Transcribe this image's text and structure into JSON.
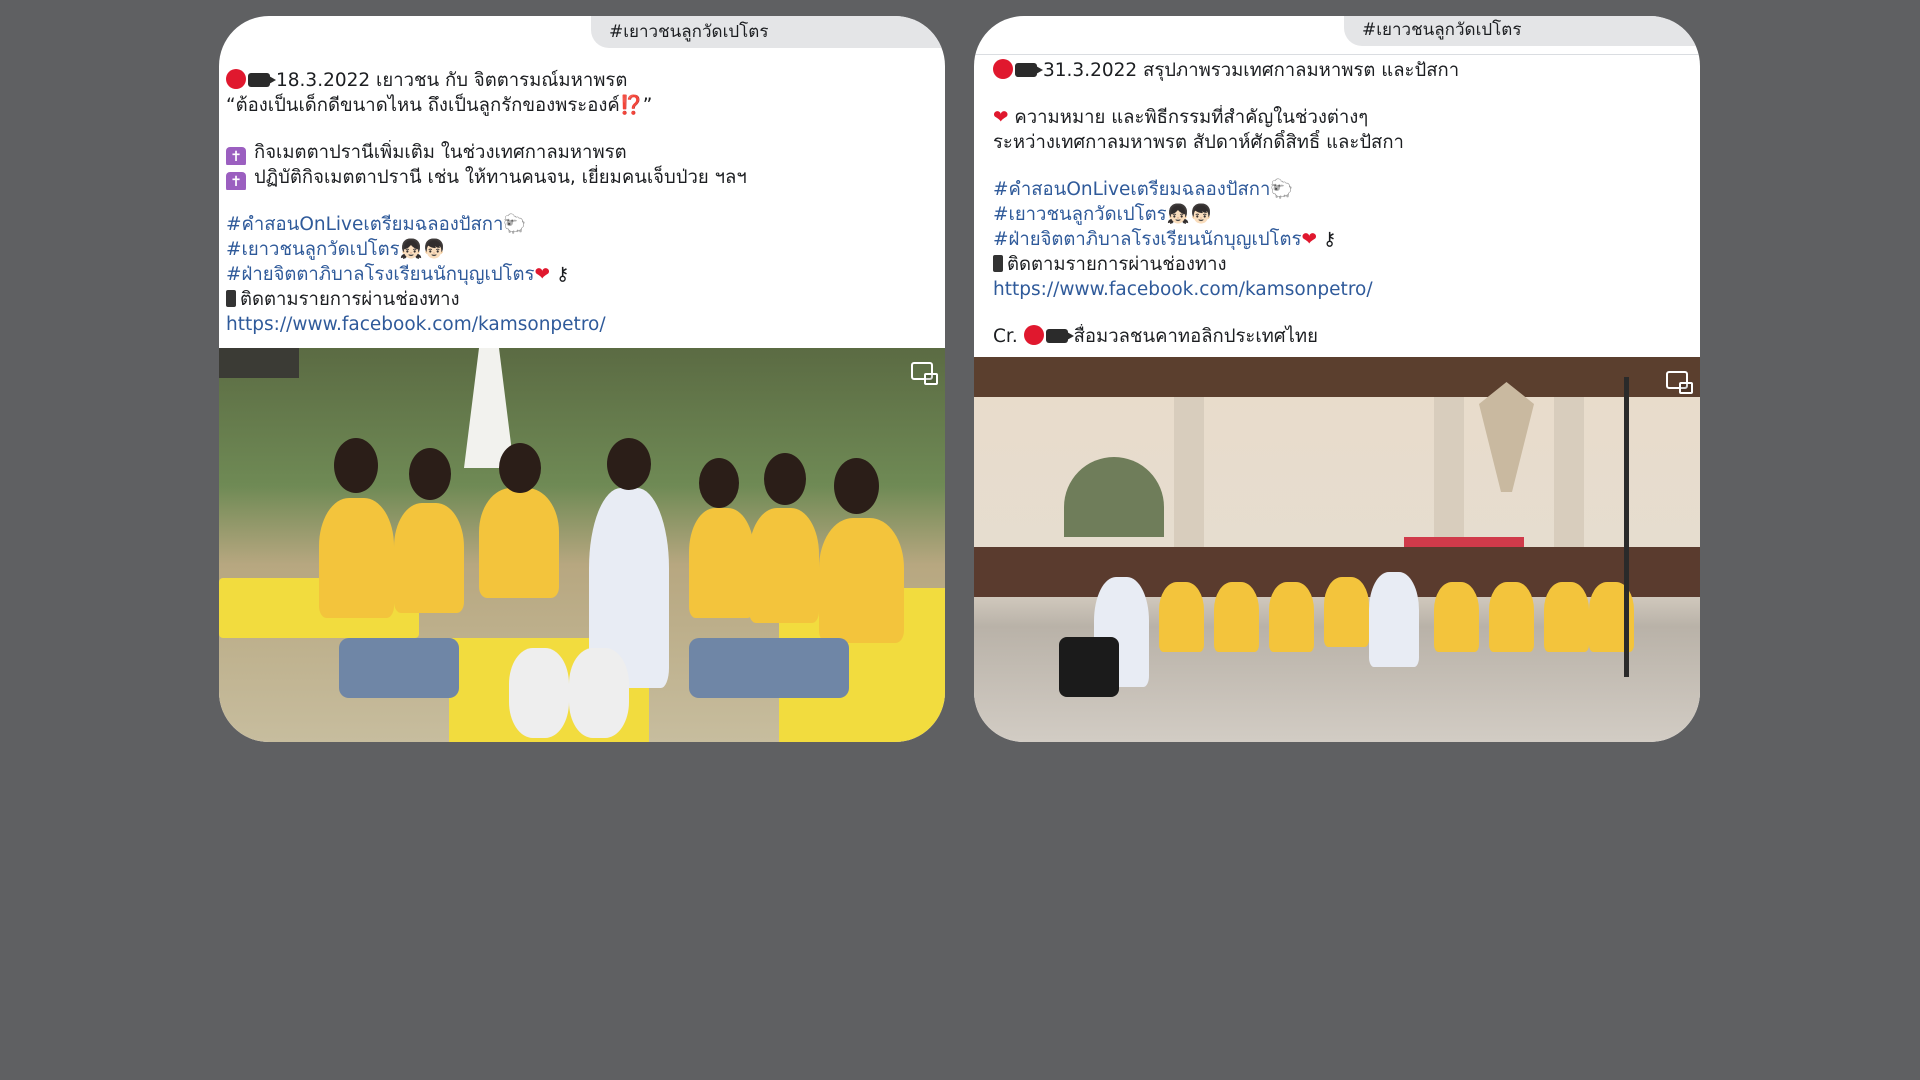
{
  "posts": [
    {
      "hashtag_chip": "#เยาวชนลูกวัดเปโตร",
      "lines": {
        "date_title": "18.3.2022 เยาวชน กับ จิตตารมณ์มหาพรต",
        "quote": "“ต้องเป็นเด็กดีขนาดไหน ถึงเป็นลูกรักของพระองค์⁉️”",
        "item1": "กิจเมตตาปรานีเพิ่มเติม ในช่วงเทศกาลมหาพรต",
        "item2": "ปฏิบัติกิจเมตตาปรานี เช่น ให้ทานคนจน, เยี่ยมคนเจ็บป่วย ฯลฯ",
        "tag1": "#คำสอนOnLiveเตรียมฉลองปัสกา🐑",
        "tag2": "#เยาวชนลูกวัดเปโตร👧🏻👦🏻",
        "tag3": "#ฝ่ายจิตตาภิบาลโรงเรียนนักบุญเปโตร",
        "follow": "ติดตามรายการผ่านช่องทาง",
        "url": "https://www.facebook.com/kamsonpetro/"
      }
    },
    {
      "hashtag_chip": "#เยาวชนลูกวัดเปโตร",
      "lines": {
        "date_title": "31.3.2022 สรุปภาพรวมเทศกาลมหาพรต และปัสกา",
        "heart_line": "ความหมาย และพิธีกรรมที่สำคัญในช่วงต่างๆ",
        "line2": "ระหว่างเทศกาลมหาพรต สัปดาห์ศักดิ์สิทธิ์ และปัสกา",
        "tag1": "#คำสอนOnLiveเตรียมฉลองปัสกา🐑",
        "tag2": "#เยาวชนลูกวัดเปโตร👧🏻👦🏻",
        "tag3": "#ฝ่ายจิตตาภิบาลโรงเรียนนักบุญเปโตร",
        "follow": "ติดตามรายการผ่านช่องทาง",
        "url": "https://www.facebook.com/kamsonpetro/",
        "credit_prefix": "Cr.",
        "credit": "สื่อมวลชนคาทอลิกประเทศไทย"
      }
    }
  ]
}
